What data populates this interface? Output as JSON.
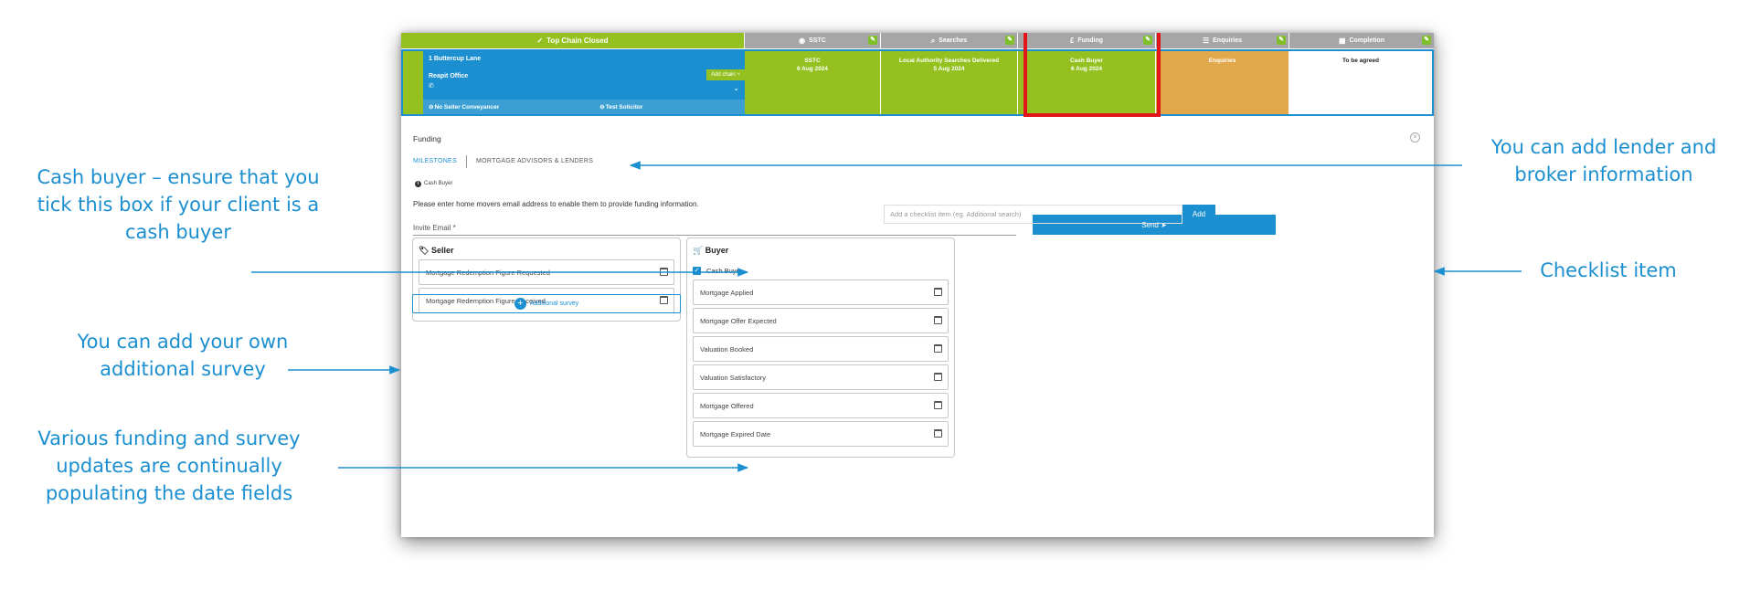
{
  "tabs": [
    {
      "label": "Top Chain Closed",
      "icon": "check-circle-icon"
    },
    {
      "label": "SSTC",
      "icon": "eye-icon"
    },
    {
      "label": "Searches",
      "icon": "search-icon"
    },
    {
      "label": "Funding",
      "icon": "pound-icon"
    },
    {
      "label": "Enquiries",
      "icon": "list-icon"
    },
    {
      "label": "Completion",
      "icon": "calendar-icon"
    }
  ],
  "chain": {
    "address": "1 Buttercup Lane",
    "office": "Reapit Office",
    "phone": "",
    "add_chain_label": "Add chain",
    "conveyancer": "No Seller Conveyancer",
    "solicitor": "Test Solicitor"
  },
  "stages": [
    {
      "title": "SSTC",
      "date": "6 Aug 2024"
    },
    {
      "title": "Local Authority Searches Delivered",
      "date": "5 Aug 2024"
    },
    {
      "title": "Cash Buyer",
      "date": "6 Aug 2024"
    },
    {
      "title": "Enquiries",
      "date": ""
    },
    {
      "title": "To be agreed",
      "date": ""
    }
  ],
  "panel": {
    "title": "Funding",
    "subtabs": [
      "MILESTONES",
      "MORTGAGE ADVISORS & LENDERS"
    ],
    "info_text": "Cash Buyer",
    "instruction": "Please enter home movers email address to enable them to provide funding information.",
    "invite_label": "Invite Email *",
    "send_label": "Send"
  },
  "seller": {
    "heading": "Seller",
    "fields": [
      "Mortgage Redemption Figure Requested",
      "Mortgage Redemption Figure Received"
    ],
    "additional_survey_label": "Additional survey"
  },
  "buyer": {
    "heading": "Buyer",
    "cash_buyer_label": "Cash Buyer",
    "cash_buyer_checked": true,
    "fields": [
      "Mortgage Applied",
      "Mortgage Offer Expected",
      "Valuation Booked",
      "Valuation Satisfactory",
      "Mortgage Offered",
      "Mortgage Expired Date"
    ]
  },
  "checklist": {
    "placeholder": "Add a checklist item (eg. Additional search)",
    "add_label": "Add"
  },
  "annotations": {
    "lender": "You can add lender and\nbroker information",
    "cash": "Cash buyer – ensure that you\ntick this box if your client is a\ncash buyer",
    "checklist": "Checklist item",
    "survey": "You can add your own\nadditional survey",
    "updates": "Various funding and survey\nupdates are continually\npopulating the date fields"
  },
  "colors": {
    "accent": "#1b8fd0",
    "green": "#94c11f",
    "orange": "#e2a84c",
    "grey": "#a6a6a6",
    "highlight": "#e3151b"
  }
}
